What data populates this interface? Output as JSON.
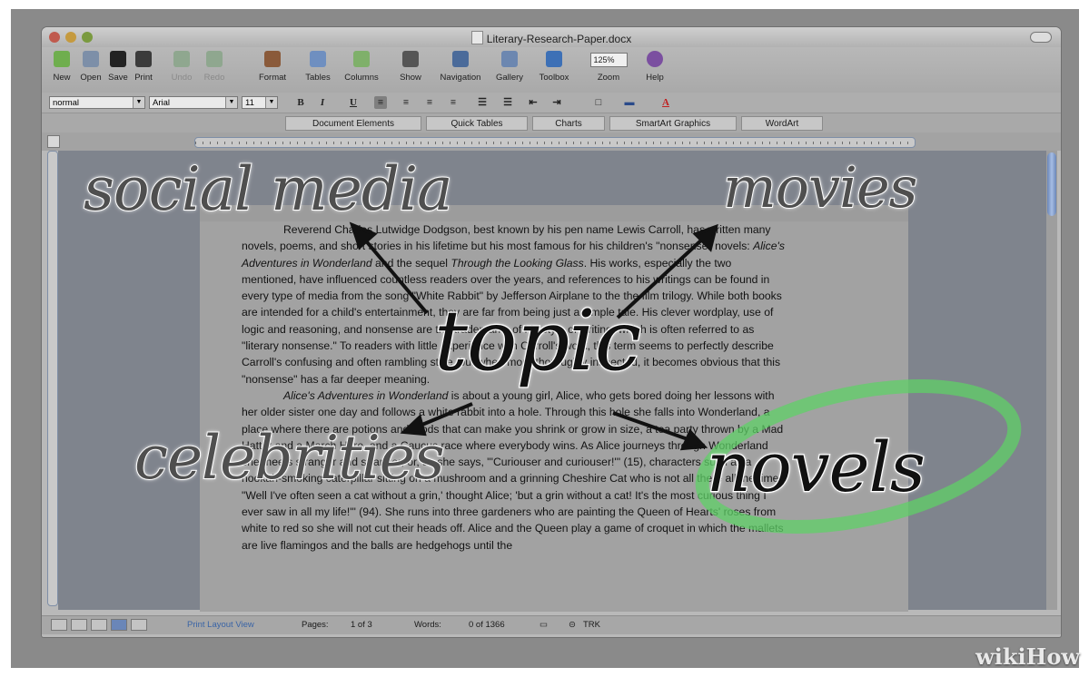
{
  "window": {
    "title": "Literary-Research-Paper.docx"
  },
  "toolbar": {
    "items": [
      {
        "label": "New",
        "enabled": true
      },
      {
        "label": "Open",
        "enabled": true
      },
      {
        "label": "Save",
        "enabled": true
      },
      {
        "label": "Print",
        "enabled": true
      },
      {
        "label": "Undo",
        "enabled": false
      },
      {
        "label": "Redo",
        "enabled": false
      },
      {
        "label": "Format",
        "enabled": true
      },
      {
        "label": "Tables",
        "enabled": true
      },
      {
        "label": "Columns",
        "enabled": true
      },
      {
        "label": "Show",
        "enabled": true
      },
      {
        "label": "Navigation",
        "enabled": true
      },
      {
        "label": "Gallery",
        "enabled": true
      },
      {
        "label": "Toolbox",
        "enabled": true
      },
      {
        "label": "Zoom",
        "enabled": true
      },
      {
        "label": "Help",
        "enabled": true
      }
    ],
    "zoom_value": "125%"
  },
  "format": {
    "style": "normal",
    "font": "Arial",
    "size": "11",
    "bold": "B",
    "italic": "I",
    "underline": "U"
  },
  "ribbon": {
    "tabs": [
      "Document Elements",
      "Quick Tables",
      "Charts",
      "SmartArt Graphics",
      "WordArt"
    ]
  },
  "document": {
    "paragraph1_parts": [
      {
        "text": "Reverend Charles Lutwidge Dodgson, best known by his pen name Lewis Carroll, has written many novels, poems, and short stories in his lifetime but his most famous for his children's \"nonsense\" novels: ",
        "italic": false
      },
      {
        "text": "Alice's Adventures in Wonderland",
        "italic": true
      },
      {
        "text": " and the sequel ",
        "italic": false
      },
      {
        "text": "Through the Looking Glass",
        "italic": true
      },
      {
        "text": ". His works, especially the two mentioned, have influenced countless readers over the years, and references to his writings can be found in every type of media from the song \"White Rabbit\" by Jefferson Airplane to the the film trilogy. While both books are intended for a child's entertainment, they are far from being just a simple tale. His clever wordplay, use of logic and reasoning, and nonsense are the trademarks of his style of writing, which is often referred to as \"literary nonsense.\" To readers with little experience with Carroll's work, this term seems to perfectly describe Carroll's confusing and often rambling style, but when more thoroughly inspected, it becomes obvious that this \"nonsense\" has a far deeper meaning.",
        "italic": false
      }
    ],
    "paragraph2_parts": [
      {
        "text": "",
        "italic": false
      },
      {
        "text": "Alice's Adventures in Wonderland",
        "italic": true
      },
      {
        "text": " is about a young girl, Alice, who gets bored doing her lessons with her older sister one day and follows a white rabbit into a hole. Through this hole she falls into Wonderland, a place where there are potions and foods that can make you shrink or grow in size, a tea party thrown by a Mad Hatter and a March Hare, and a Caucus race where everybody wins. As Alice journeys through Wonderland she meets stranger and stranger, or, as she says, \"'Curiouser and curiouser!'\" (15), characters such as a hookah-smoking caterpillar sitting on a mushroom and a grinning Cheshire Cat who is not all there all the time: \"Well I've often seen a cat without a grin,' thought Alice; 'but a grin without a cat! It's the most curious thing I ever saw in all my life!'\" (94). She runs into three gardeners who are painting the Queen of Hearts' roses from white to red so she will not cut their heads off. Alice and the Queen play a game of croquet in which the mallets are live flamingos and the balls are hedgehogs until the",
        "italic": false
      }
    ]
  },
  "statusbar": {
    "view": "Print Layout View",
    "pages_label": "Pages:",
    "pages_value": "1 of 3",
    "words_label": "Words:",
    "words_value": "0 of 1366",
    "trk": "TRK"
  },
  "annotations": {
    "center": "topic",
    "top_left": "social media",
    "top_right": "movies",
    "bottom_left": "celebrities",
    "bottom_right": "novels"
  },
  "watermark": "wikiHow",
  "colors": {
    "highlight_circle": "#5fd067",
    "accent_blue": "#6a86b8"
  }
}
